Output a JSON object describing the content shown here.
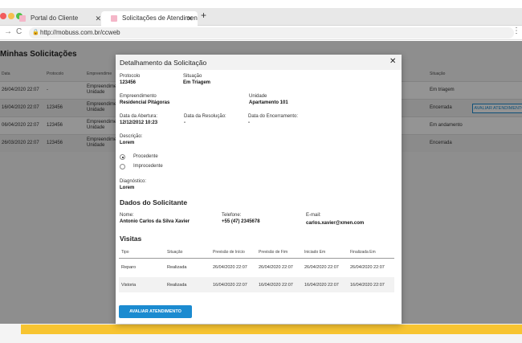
{
  "browser": {
    "dots": [
      "#f25c5c",
      "#f5bf4f",
      "#51c149"
    ],
    "tabs": [
      {
        "label": "Portal do Cliente"
      },
      {
        "label": "Solicitações de Atendimen"
      }
    ],
    "url": "http://mobuss.com.br/ccweb"
  },
  "page": {
    "title": "Minhas Solicitações",
    "columns": [
      "Data",
      "Protocolo",
      "Empreendime",
      "Situação"
    ],
    "rows": [
      {
        "data": "26/04/2020 22:07",
        "protocolo": "-",
        "emp1": "Empreendime",
        "emp2": "Unidade",
        "situacao": "Em triagem"
      },
      {
        "data": "16/04/2020 22:07",
        "protocolo": "123456",
        "emp1": "Empreendime",
        "emp2": "Unidade",
        "situacao": "Encerrada"
      },
      {
        "data": "06/04/2020 22:07",
        "protocolo": "123456",
        "emp1": "Empreendime",
        "emp2": "Unidade",
        "situacao": "Em andamento"
      },
      {
        "data": "26/03/2020 22:07",
        "protocolo": "123456",
        "emp1": "Empreendime",
        "emp2": "Unidade",
        "situacao": "Encerrada"
      }
    ],
    "row_action": "AVALIAR ATENDIMENTO"
  },
  "modal": {
    "title": "Detalhamento da Solicitação",
    "protocolo_label": "Protocolo",
    "protocolo": "123456",
    "situacao_label": "Situação",
    "situacao": "Em Triagem",
    "empreendimento_label": "Empreendimento",
    "empreendimento": "Residencial Pitágoras",
    "unidade_label": "Unidade",
    "unidade": "Apartamento 101",
    "abertura_label": "Data da Abertura:",
    "abertura": "12/12/2012 10:23",
    "resolucao_label": "Data da Resolução:",
    "resolucao": "-",
    "encerramento_label": "Data do Encerramento:",
    "encerramento": "-",
    "descricao_label": "Descrição:",
    "descricao": "Lorem",
    "radio_procedente": "Procedente",
    "radio_improcedente": "Improcedente",
    "diagnostico_label": "Diagnóstico:",
    "diagnostico": "Lorem",
    "solicitante_title": "Dados do Solicitante",
    "nome_label": "Nome:",
    "nome": "Antonio Carlos da Silva Xavier",
    "telefone_label": "Telefone:",
    "telefone": "+55 (47) 2345678",
    "email_label": "E-mail:",
    "email": "carlos.xavier@xmen.com",
    "visitas_title": "Visitas",
    "visitas_headers": [
      "Tipo",
      "Situação",
      "Previsão de Início",
      "Previsão de Fim",
      "Iniciado Em",
      "Finalizada Em"
    ],
    "visitas": [
      {
        "tipo": "Reparo",
        "situacao": "Realizada",
        "prev_inicio": "26/04/2020 22:07",
        "prev_fim": "26/04/2020 22:07",
        "iniciado": "26/04/2020 22:07",
        "finalizada": "26/04/2020 22:07"
      },
      {
        "tipo": "Vistoria",
        "situacao": "Realizada",
        "prev_inicio": "16/04/2020 22:07",
        "prev_fim": "16/04/2020 22:07",
        "iniciado": "16/04/2020 22:07",
        "finalizada": "16/04/2020 22:07"
      }
    ],
    "avaliar_button": "AVALIAR ATENDIMENTO"
  }
}
